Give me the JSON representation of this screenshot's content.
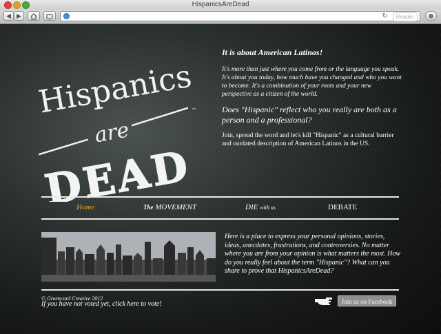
{
  "window": {
    "title": "HispanicsAreDead",
    "reader_label": "Reader"
  },
  "toolbar": {
    "back_icon": "back-arrow-icon",
    "forward_icon": "forward-arrow-icon",
    "home_icon": "home-icon",
    "bookmarks_icon": "bookmarks-icon",
    "address_value": ""
  },
  "logo": {
    "line1": "Hispanics",
    "line2": "are",
    "line3": "DEAD",
    "trademark": "™"
  },
  "intro": {
    "heading": "It is about American Latinos!",
    "paragraph": "It's more than just where you come from or the language you speak. It's about you today, how much have you changed and who you want to become. It's a combination of your roots and your new perspective as a citizen of the world.",
    "question": "Does \"Hispanic\" reflect who you really are both as a person and a professional?",
    "join": "Join, spread the word and let's kill \"Hispanic\" as a cultural barrier and outdated description of American Latinos in the US."
  },
  "nav": {
    "home": "Home",
    "movement_prefix": "The",
    "movement": "MOVEMENT",
    "die": "DIE",
    "die_suffix": "with us",
    "debate": "DEBATE"
  },
  "body_text": "Here is a place to express your personal opinions, stories, ideas, anecdotes, frustrations, and controversies. No matter where you are from your opinion is what matters the most. How do you really feel about the term \"Hispanic\"? What can you share to prove that HispanicsAreDead?",
  "footer": {
    "copyright": "© Greencard Creative 2012",
    "vote_link": "If you have not voted yet, click here to vote!",
    "facebook_button": "Join us on Facebook"
  },
  "colors": {
    "nav_active": "#e9a23b",
    "text": "#ffffff",
    "facebook_button": "#8e8e8e"
  }
}
